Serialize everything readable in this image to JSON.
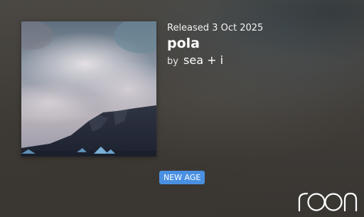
{
  "album": {
    "release_text": "Released 3 Oct 2025",
    "title": "pola",
    "by_label": "by",
    "artist": "sea + i",
    "cover_icon": "album-cover-mountain-clouds"
  },
  "genre": {
    "label": "NEW AGE",
    "color": "#4a90e2"
  },
  "brand": {
    "logo_text": "roon",
    "logo_icon": "roon-logo-icon"
  }
}
